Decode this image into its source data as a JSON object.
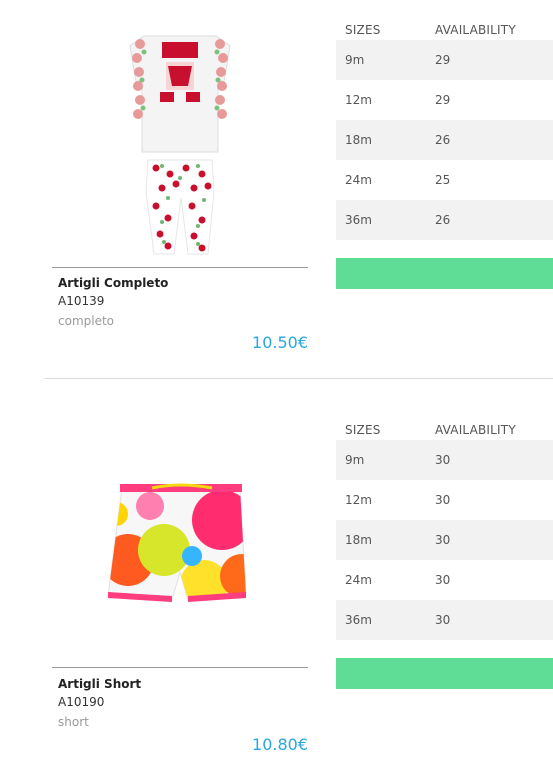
{
  "table_headers": {
    "sizes": "SIZES",
    "availability": "AVAILABILITY"
  },
  "products": [
    {
      "name": "Artigli Completo",
      "code": "A10139",
      "category": "completo",
      "price": "10.50€",
      "rows": [
        {
          "size": "9m",
          "qty": "29"
        },
        {
          "size": "12m",
          "qty": "29"
        },
        {
          "size": "18m",
          "qty": "26"
        },
        {
          "size": "24m",
          "qty": "25"
        },
        {
          "size": "36m",
          "qty": "26"
        }
      ]
    },
    {
      "name": "Artigli Short",
      "code": "A10190",
      "category": "short",
      "price": "10.80€",
      "rows": [
        {
          "size": "9m",
          "qty": "30"
        },
        {
          "size": "12m",
          "qty": "30"
        },
        {
          "size": "18m",
          "qty": "30"
        },
        {
          "size": "24m",
          "qty": "30"
        },
        {
          "size": "36m",
          "qty": "30"
        }
      ]
    }
  ],
  "colors": {
    "price": "#2aa6df",
    "button": "#5fdd97",
    "row_alt": "#f2f2f2"
  }
}
